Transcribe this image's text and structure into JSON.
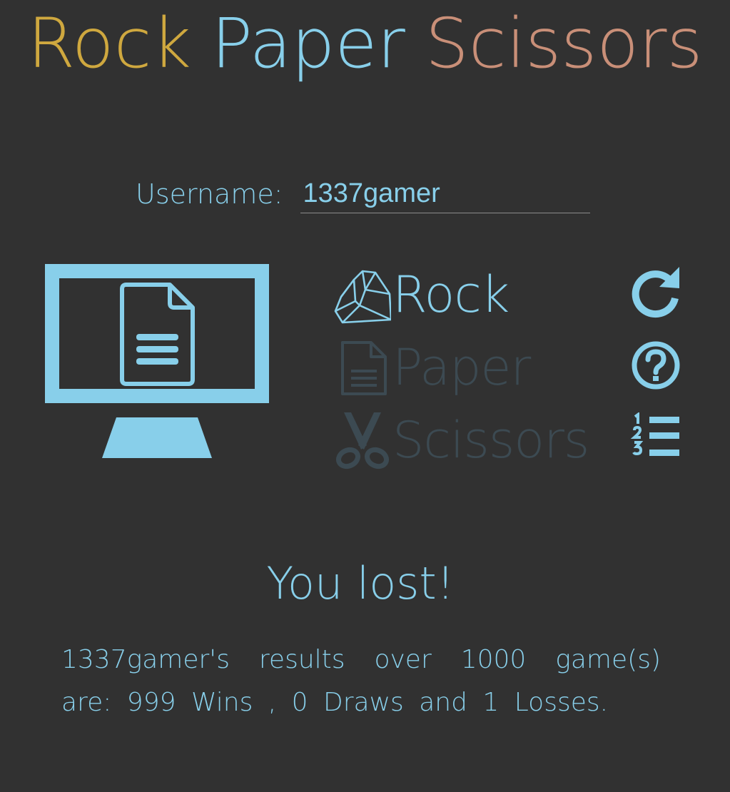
{
  "title": {
    "rock": "Rock",
    "paper": "Paper",
    "scissors": "Scissors",
    "colors": {
      "rock": "#cfa83f",
      "paper": "#88cfea",
      "scissors": "#c98f78"
    }
  },
  "username": {
    "label": "Username:",
    "value": "1337gamer"
  },
  "computer_choice": {
    "icon": "computer-paper-icon"
  },
  "choices": [
    {
      "label": "Rock",
      "icon": "rock-icon",
      "state": "selected"
    },
    {
      "label": "Paper",
      "icon": "paper-icon",
      "state": "inactive"
    },
    {
      "label": "Scissors",
      "icon": "scissors-icon",
      "state": "inactive"
    }
  ],
  "side_buttons": [
    {
      "icon": "refresh-icon"
    },
    {
      "icon": "help-icon"
    },
    {
      "icon": "leaderboard-icon"
    }
  ],
  "result": {
    "title": "You lost!",
    "summary": "1337gamer's results over 1000 game(s) are: 999 Wins , 0 Draws and 1 Losses."
  },
  "colors": {
    "accent": "#88cfea",
    "inactive": "#3c4a52",
    "background": "#313131"
  }
}
